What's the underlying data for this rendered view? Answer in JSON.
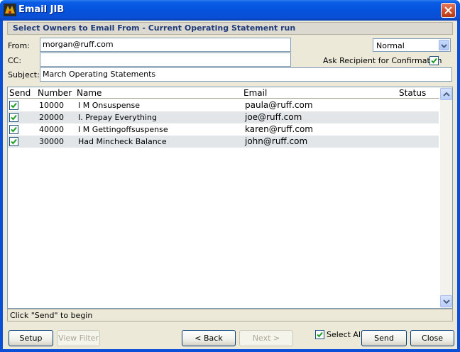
{
  "window": {
    "title": "Email JIB"
  },
  "header": {
    "text": "Select Owners to Email From - Current Operating Statement run"
  },
  "form": {
    "from_label": "From:",
    "from_value": "morgan@ruff.com",
    "cc_label": "CC:",
    "cc_value": "",
    "subject_label": "Subject:",
    "subject_value": "March Operating Statements",
    "priority_value": "Normal",
    "confirm_label": "Ask Recipient for Confirmation",
    "confirm_checked": true
  },
  "grid": {
    "columns": [
      "Send",
      "Number",
      "Name",
      "Email",
      "Status"
    ],
    "rows": [
      {
        "send": true,
        "number": "10000",
        "name": "I M Onsuspense",
        "email": "paula@ruff.com",
        "status": ""
      },
      {
        "send": true,
        "number": "20000",
        "name": "I. Prepay Everything",
        "email": "joe@ruff.com",
        "status": ""
      },
      {
        "send": true,
        "number": "40000",
        "name": "I M Gettingoffsuspense",
        "email": "karen@ruff.com",
        "status": ""
      },
      {
        "send": true,
        "number": "30000",
        "name": "Had Mincheck Balance",
        "email": "john@ruff.com",
        "status": ""
      }
    ]
  },
  "status_text": "Click \"Send\" to begin",
  "buttons": {
    "setup": "Setup",
    "view_filter": "View Filter",
    "back": "< Back",
    "next": "Next >",
    "select_all": "Select All",
    "send": "Send",
    "close": "Close"
  },
  "icons": {
    "close": "close-icon",
    "check": "checkmark-icon",
    "scroll_up": "chevron-up-icon",
    "scroll_down": "chevron-down-icon",
    "dropdown": "chevron-down-icon"
  },
  "colors": {
    "titlebar": "#0453dc",
    "header_text": "#1f3a78",
    "check": "#1b9e22",
    "alt_row": "#e2e6e9"
  }
}
